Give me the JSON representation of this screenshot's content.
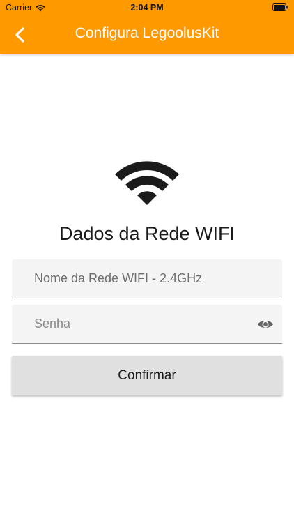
{
  "status_bar": {
    "carrier": "Carrier",
    "time": "2:04 PM"
  },
  "nav": {
    "title": "Configura LegoolusKit",
    "back_icon": "chevron-left-icon"
  },
  "colors": {
    "accent": "#fe9900",
    "field_bg": "#f4f4f4",
    "button_bg": "#e0e0e0"
  },
  "main": {
    "icon": "wifi-icon",
    "heading": "Dados da Rede WIFI",
    "network_field": {
      "placeholder": "Nome da Rede WIFI - 2.4GHz",
      "value": ""
    },
    "password_field": {
      "placeholder": "Senha",
      "value": "",
      "toggle_icon": "eye-icon"
    },
    "confirm_label": "Confirmar"
  }
}
